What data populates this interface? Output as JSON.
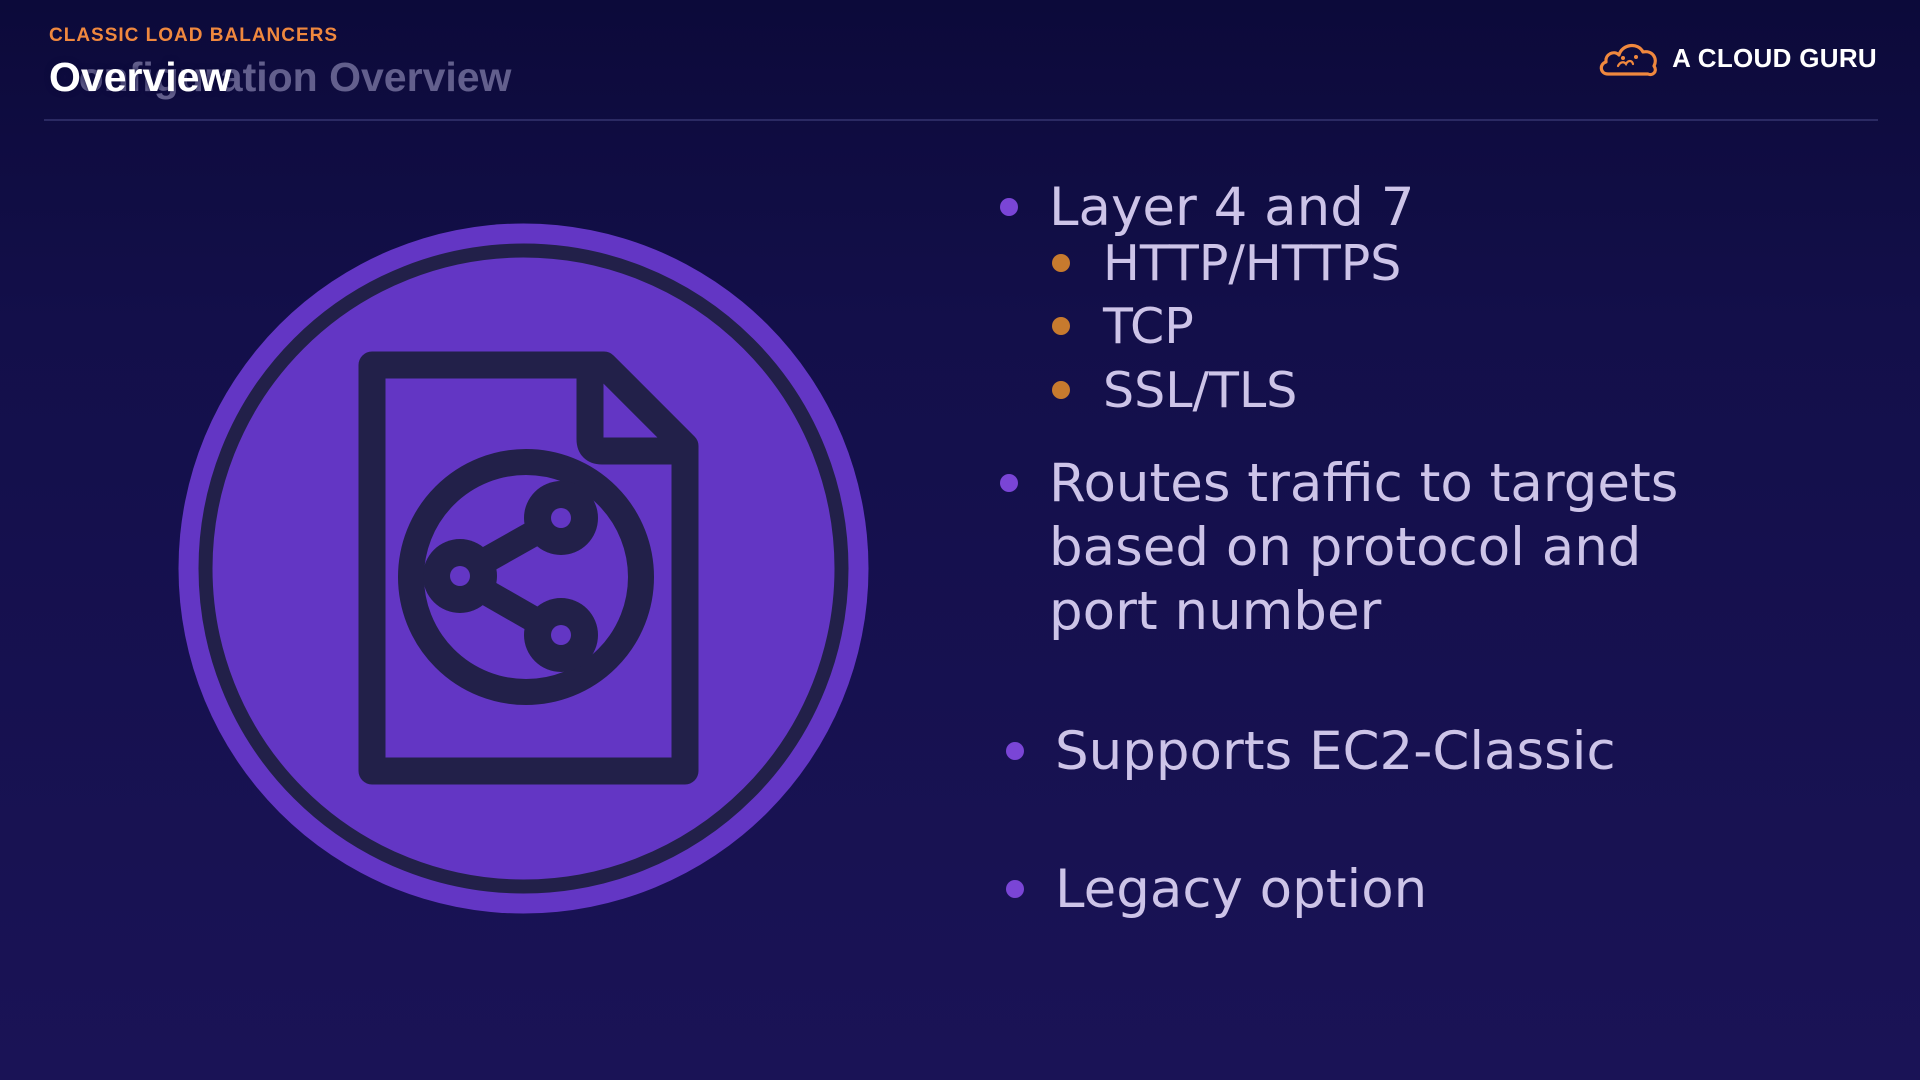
{
  "header": {
    "kicker": "CLASSIC LOAD BALANCERS",
    "title": "Overview",
    "ghost_title": "Configuration Overview"
  },
  "brand": {
    "name": "A CLOUD GURU",
    "logo_icon": "cloud-logo-icon",
    "logo_color": "#f0883e"
  },
  "hero_icon": {
    "name": "shared-document-icon",
    "circle_color": "#6336c4",
    "outline_color": "#222049"
  },
  "colors": {
    "bullet_primary": "#7a45d6",
    "bullet_secondary": "#c77a2e",
    "text": "#cdc4e8"
  },
  "bullets": [
    {
      "text": "Layer 4 and 7",
      "sub": [
        "HTTP/HTTPS",
        "TCP",
        "SSL/TLS"
      ]
    },
    {
      "lines": [
        "Routes traffic to targets",
        "based on protocol and",
        "port number"
      ]
    },
    {
      "text": "Supports EC2-Classic"
    },
    {
      "text": "Legacy option"
    }
  ]
}
